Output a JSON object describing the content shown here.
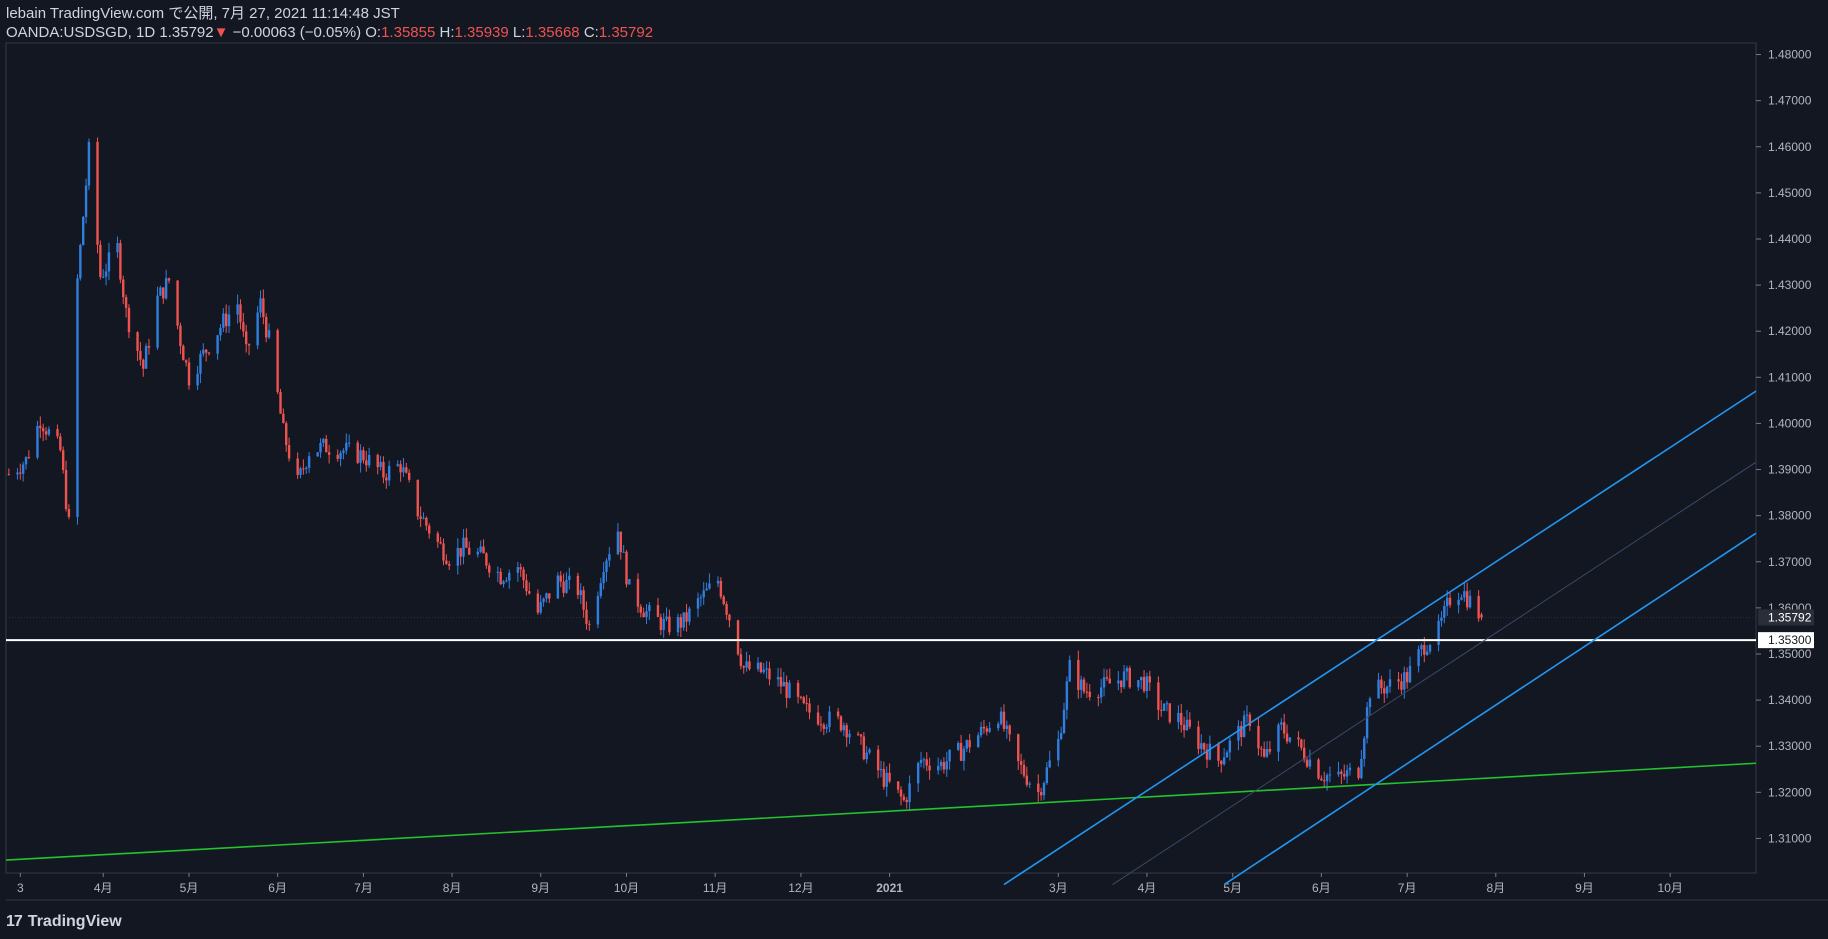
{
  "header": {
    "line1": "lebain TradingView.com で公開, 7月 27, 2021 11:14:48 JST",
    "symbol": "OANDA:USDSGD, 1D",
    "last": "1.35792",
    "change_arrow": "▼",
    "change": "−0.00063 (−0.05%)",
    "o_label": "O:",
    "o_val": "1.35855",
    "h_label": "H:",
    "h_val": "1.35939",
    "l_label": "L:",
    "l_val": "1.35668",
    "c_label": "C:",
    "c_val": "1.35792"
  },
  "brand": {
    "logo": "17",
    "name": "TradingView"
  },
  "colors": {
    "background": "#131722",
    "up": "#2962ff",
    "up_body": "#2f7fe0",
    "down": "#ef5350",
    "channel": "#2196f3",
    "support": "#22c32e",
    "level_line": "#ffffff"
  },
  "chart_data": {
    "type": "candlestick",
    "symbol": "OANDA:USDSGD",
    "interval": "1D",
    "ylim": [
      1.3025,
      1.4825
    ],
    "y_ticks": [
      "1.48000",
      "1.47000",
      "1.46000",
      "1.45000",
      "1.44000",
      "1.43000",
      "1.42000",
      "1.41000",
      "1.40000",
      "1.39000",
      "1.38000",
      "1.37000",
      "1.36000",
      "1.35000",
      "1.34000",
      "1.33000",
      "1.32000",
      "1.31000"
    ],
    "x_ticks": [
      "3",
      "4月",
      "5月",
      "6月",
      "7月",
      "8月",
      "9月",
      "10月",
      "11月",
      "12月",
      "2021",
      "3月",
      "4月",
      "5月",
      "6月",
      "7月",
      "8月",
      "9月",
      "10月"
    ],
    "last_price_label": "1.35792",
    "horizontal_level_label": "1.35300",
    "horizontal_level": 1.353,
    "series": [
      {
        "name": "price-path",
        "points": [
          [
            "2020-02-28",
            1.389
          ],
          [
            "2020-03-05",
            1.392
          ],
          [
            "2020-03-10",
            1.401
          ],
          [
            "2020-03-17",
            1.394
          ],
          [
            "2020-03-20",
            1.378
          ],
          [
            "2020-03-23",
            1.431
          ],
          [
            "2020-03-27",
            1.459
          ],
          [
            "2020-03-31",
            1.432
          ],
          [
            "2020-04-06",
            1.438
          ],
          [
            "2020-04-09",
            1.424
          ],
          [
            "2020-04-15",
            1.412
          ],
          [
            "2020-04-20",
            1.427
          ],
          [
            "2020-04-24",
            1.431
          ],
          [
            "2020-04-28",
            1.418
          ],
          [
            "2020-05-01",
            1.41
          ],
          [
            "2020-05-08",
            1.417
          ],
          [
            "2020-05-13",
            1.422
          ],
          [
            "2020-05-18",
            1.426
          ],
          [
            "2020-05-21",
            1.415
          ],
          [
            "2020-05-26",
            1.426
          ],
          [
            "2020-05-29",
            1.418
          ],
          [
            "2020-06-03",
            1.398
          ],
          [
            "2020-06-08",
            1.387
          ],
          [
            "2020-06-12",
            1.394
          ],
          [
            "2020-06-18",
            1.395
          ],
          [
            "2020-06-25",
            1.394
          ],
          [
            "2020-07-01",
            1.393
          ],
          [
            "2020-07-08",
            1.389
          ],
          [
            "2020-07-14",
            1.391
          ],
          [
            "2020-07-20",
            1.381
          ],
          [
            "2020-07-27",
            1.374
          ],
          [
            "2020-07-31",
            1.371
          ],
          [
            "2020-08-05",
            1.373
          ],
          [
            "2020-08-12",
            1.371
          ],
          [
            "2020-08-18",
            1.367
          ],
          [
            "2020-08-24",
            1.369
          ],
          [
            "2020-08-31",
            1.359
          ],
          [
            "2020-09-07",
            1.366
          ],
          [
            "2020-09-14",
            1.364
          ],
          [
            "2020-09-18",
            1.356
          ],
          [
            "2020-09-23",
            1.37
          ],
          [
            "2020-09-28",
            1.377
          ],
          [
            "2020-10-02",
            1.364
          ],
          [
            "2020-10-08",
            1.359
          ],
          [
            "2020-10-15",
            1.356
          ],
          [
            "2020-10-21",
            1.357
          ],
          [
            "2020-10-27",
            1.362
          ],
          [
            "2020-11-02",
            1.366
          ],
          [
            "2020-11-06",
            1.358
          ],
          [
            "2020-11-11",
            1.347
          ],
          [
            "2020-11-18",
            1.346
          ],
          [
            "2020-11-25",
            1.343
          ],
          [
            "2020-12-02",
            1.338
          ],
          [
            "2020-12-09",
            1.336
          ],
          [
            "2020-12-16",
            1.335
          ],
          [
            "2020-12-22",
            1.33
          ],
          [
            "2020-12-30",
            1.323
          ],
          [
            "2021-01-06",
            1.318
          ],
          [
            "2021-01-12",
            1.327
          ],
          [
            "2021-01-19",
            1.326
          ],
          [
            "2021-01-26",
            1.329
          ],
          [
            "2021-02-02",
            1.333
          ],
          [
            "2021-02-08",
            1.337
          ],
          [
            "2021-02-15",
            1.326
          ],
          [
            "2021-02-22",
            1.32
          ],
          [
            "2021-03-01",
            1.331
          ],
          [
            "2021-03-05",
            1.347
          ],
          [
            "2021-03-10",
            1.342
          ],
          [
            "2021-03-17",
            1.343
          ],
          [
            "2021-03-24",
            1.345
          ],
          [
            "2021-03-31",
            1.344
          ],
          [
            "2021-04-06",
            1.338
          ],
          [
            "2021-04-12",
            1.336
          ],
          [
            "2021-04-19",
            1.331
          ],
          [
            "2021-04-26",
            1.327
          ],
          [
            "2021-05-03",
            1.333
          ],
          [
            "2021-05-07",
            1.336
          ],
          [
            "2021-05-12",
            1.327
          ],
          [
            "2021-05-18",
            1.334
          ],
          [
            "2021-05-24",
            1.33
          ],
          [
            "2021-06-01",
            1.324
          ],
          [
            "2021-06-07",
            1.323
          ],
          [
            "2021-06-14",
            1.325
          ],
          [
            "2021-06-18",
            1.342
          ],
          [
            "2021-06-24",
            1.343
          ],
          [
            "2021-07-01",
            1.345
          ],
          [
            "2021-07-07",
            1.352
          ],
          [
            "2021-07-12",
            1.355
          ],
          [
            "2021-07-16",
            1.362
          ],
          [
            "2021-07-20",
            1.364
          ],
          [
            "2021-07-27",
            1.3579
          ]
        ]
      }
    ],
    "lines": [
      {
        "name": "support-trendline",
        "color": "#22c32e",
        "from": [
          "2020-02-27",
          1.3053
        ],
        "to": [
          "2021-10-31",
          1.3263
        ]
      },
      {
        "name": "channel-upper",
        "color": "#2196f3",
        "from": [
          "2021-02-10",
          1.3
        ],
        "to": [
          "2021-10-31",
          1.407
        ]
      },
      {
        "name": "channel-lower",
        "color": "#2196f3",
        "from": [
          "2021-04-28",
          1.3
        ],
        "to": [
          "2021-10-31",
          1.3762
        ]
      },
      {
        "name": "channel-mid",
        "color": "#3a4b68",
        "from": [
          "2021-03-20",
          1.3
        ],
        "to": [
          "2021-10-31",
          1.3916
        ]
      }
    ]
  }
}
